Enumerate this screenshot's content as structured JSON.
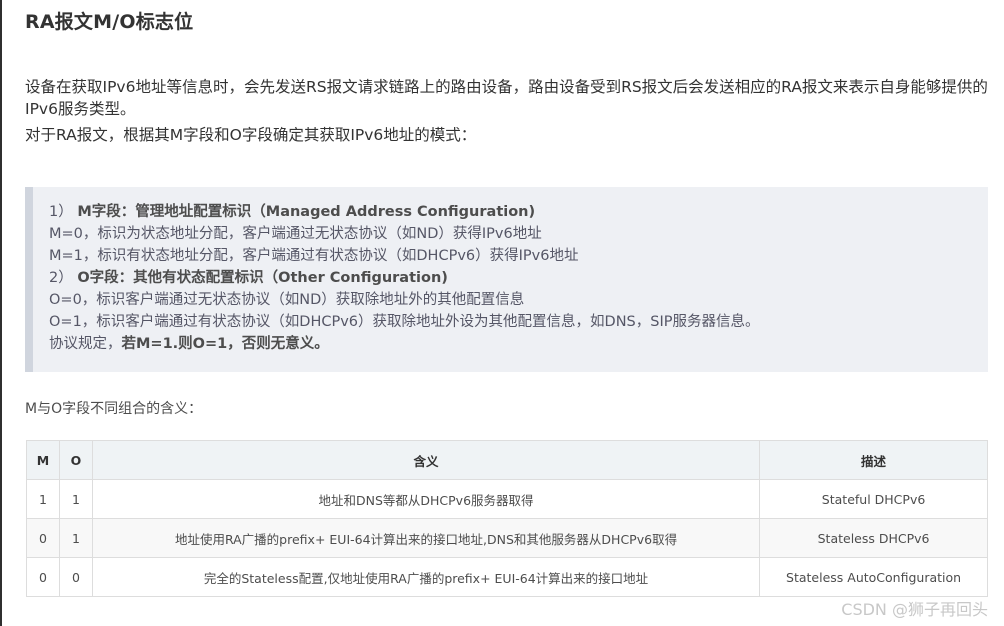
{
  "title": "RA报文M/O标志位",
  "intro": {
    "line1": "设备在获取IPv6地址等信息时，会先发送RS报文请求链路上的路由设备，路由设备受到RS报文后会发送相应的RA报文来表示自身能够提供的IPv6服务类型。",
    "line2": "对于RA报文，根据其M字段和O字段确定其获取IPv6地址的模式："
  },
  "quote": {
    "m_num": "1）",
    "m_heading": "M字段：管理地址配置标识（Managed Address Configuration)",
    "m0": "M=0，标识为状态地址分配，客户端通过无状态协议（如ND）获得IPv6地址",
    "m1": "M=1，标识有状态地址分配，客户端通过有状态协议（如DHCPv6）获得IPv6地址",
    "o_num": "2）",
    "o_heading": "O字段：其他有状态配置标识（Other Configuration)",
    "o0": "O=0，标识客户端通过无状态协议（如ND）获取除地址外的其他配置信息",
    "o1": "O=1，标识客户端通过有状态协议（如DHCPv6）获取除地址外设为其他配置信息，如DNS，SIP服务器信息。",
    "rule_prefix": "协议规定，",
    "rule_bold": "若M=1.则O=1，否则无意义。"
  },
  "table_intro": "M与O字段不同组合的含义：",
  "table": {
    "headers": [
      "M",
      "O",
      "含义",
      "描述"
    ],
    "rows": [
      [
        "1",
        "1",
        "地址和DNS等都从DHCPv6服务器取得",
        "Stateful DHCPv6"
      ],
      [
        "0",
        "1",
        "地址使用RA广播的prefix+ EUI-64计算出来的接口地址,DNS和其他服务器从DHCPv6取得",
        "Stateless DHCPv6"
      ],
      [
        "0",
        "0",
        "完全的Stateless配置,仅地址使用RA广播的prefix+ EUI-64计算出来的接口地址",
        "Stateless AutoConfiguration"
      ]
    ]
  },
  "watermark": "CSDN @狮子再回头"
}
